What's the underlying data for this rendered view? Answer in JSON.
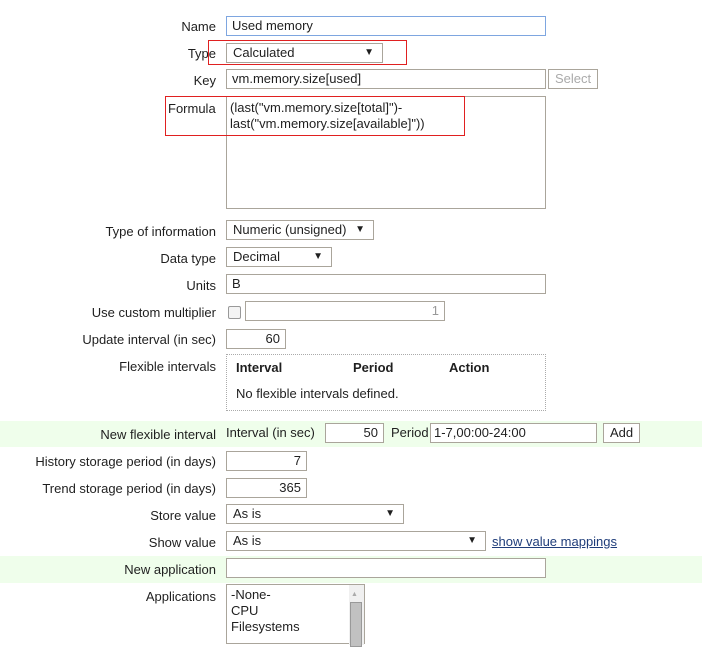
{
  "form": {
    "name": {
      "label": "Name",
      "value": "Used memory"
    },
    "type": {
      "label": "Type",
      "value": "Calculated"
    },
    "key": {
      "label": "Key",
      "value": "vm.memory.size[used]",
      "select_label": "Select"
    },
    "formula": {
      "label": "Formula",
      "line1": "(last(\"vm.memory.size[total]\")-",
      "line2": "last(\"vm.memory.size[available]\"))"
    },
    "type_of_information": {
      "label": "Type of information",
      "value": "Numeric (unsigned)"
    },
    "data_type": {
      "label": "Data type",
      "value": "Decimal"
    },
    "units": {
      "label": "Units",
      "value": "B"
    },
    "custom_multiplier": {
      "label": "Use custom multiplier",
      "checked": false,
      "value": "1"
    },
    "update_interval": {
      "label": "Update interval (in sec)",
      "value": "60"
    },
    "flexible_intervals": {
      "label": "Flexible intervals",
      "headers": [
        "Interval",
        "Period",
        "Action"
      ],
      "empty": "No flexible intervals defined."
    },
    "new_flexible_interval": {
      "label": "New flexible interval",
      "interval_label": "Interval (in sec)",
      "interval_value": "50",
      "period_label": "Period",
      "period_value": "1-7,00:00-24:00",
      "add_label": "Add"
    },
    "history": {
      "label": "History storage period (in days)",
      "value": "7"
    },
    "trend": {
      "label": "Trend storage period (in days)",
      "value": "365"
    },
    "store_value": {
      "label": "Store value",
      "value": "As is"
    },
    "show_value": {
      "label": "Show value",
      "value": "As is",
      "link": "show value mappings"
    },
    "new_application": {
      "label": "New application",
      "value": ""
    },
    "applications": {
      "label": "Applications",
      "items": [
        "-None-",
        "CPU",
        "Filesystems"
      ]
    }
  },
  "colors": {
    "highlight_row": "#effeeb",
    "annotation": "#e02020",
    "link": "#1f3d7a"
  }
}
